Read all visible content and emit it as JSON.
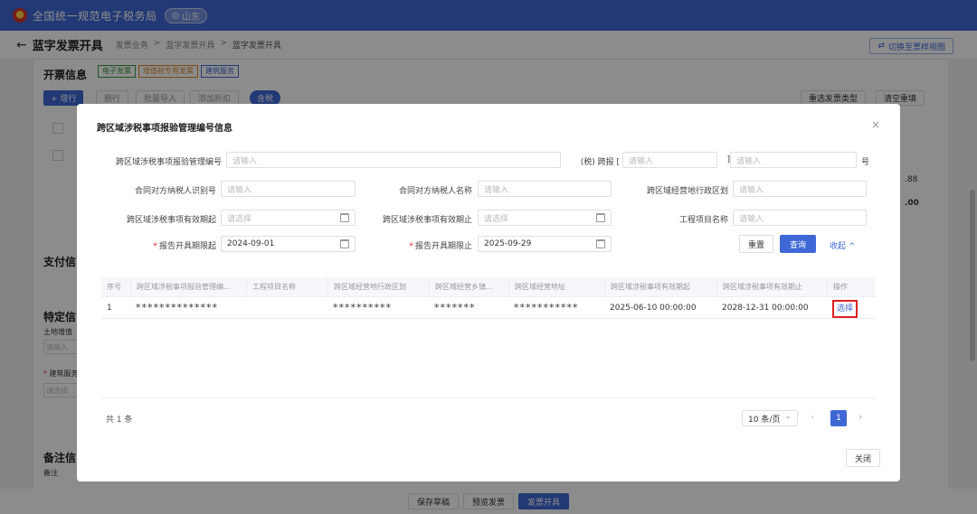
{
  "topbar": {
    "title": "全国统一规范电子税务局",
    "region": "山东"
  },
  "page": {
    "title": "蓝字发票开具",
    "breadcrumb": [
      "发票业务",
      "蓝字发票开具",
      "蓝字发票开具"
    ],
    "switch_label": "切换至票样视图"
  },
  "background": {
    "invoice_info_title": "开票信息",
    "tags": [
      "电子发票",
      "增值税专用发票",
      "建筑服务"
    ],
    "add_row": "+ 增行",
    "toolbar_extra": [
      "删行",
      "批量导入",
      "添加折扣",
      "含税"
    ],
    "select_type": "重选发票类型",
    "clear_fill": "清空重填",
    "payment_title": "支付信",
    "specific_title": "特定信",
    "land_label": "土地增值",
    "land_placeholder": "请输入",
    "construction_label": "建筑服务",
    "construction_placeholder": "请选择",
    "remark_title": "备注信",
    "remark_label": "备注",
    "right_values": [
      ".88",
      ".00"
    ]
  },
  "modal": {
    "title": "跨区域涉税事项报验管理编号信息",
    "form": {
      "mgmt_no_label": "跨区域涉税事项报验管理编号",
      "mgmt_no_placeholder": "请输入",
      "tax_prefix": "(税) 跨报 [",
      "tax_placeholder_1": "请输入",
      "bracket_close": "]",
      "tax_placeholder_2": "请输入",
      "suffix": "号",
      "counterpart_id_label": "合同对方纳税人识别号",
      "counterpart_id_placeholder": "请输入",
      "counterpart_name_label": "合同对方纳税人名称",
      "counterpart_name_placeholder": "请输入",
      "region_label": "跨区域经营地行政区划",
      "region_placeholder": "请输入",
      "valid_start_label": "跨区域涉税事项有效期起",
      "valid_start_placeholder": "请选择",
      "valid_end_label": "跨区域涉税事项有效期止",
      "valid_end_placeholder": "请选择",
      "project_label": "工程项目名称",
      "project_placeholder": "请输入",
      "report_start_label": "报告开具期限起",
      "report_start_value": "2024-09-01",
      "report_end_label": "报告开具期限止",
      "report_end_value": "2025-09-29",
      "reset": "重置",
      "query": "查询",
      "collapse": "收起 ^"
    },
    "table": {
      "headers": [
        "序号",
        "跨区域涉税事项报验管理编...",
        "工程项目名称",
        "跨区域经营地行政区划",
        "跨区域经营乡镇...",
        "跨区域经营地址",
        "跨区域涉税事项有效期起",
        "跨区域涉税事项有效期止",
        "操作"
      ],
      "rows": [
        [
          "1",
          "**************",
          "",
          "**********",
          "*******",
          "***********",
          "2025-06-10 00:00:00",
          "2028-12-31 00:00:00",
          "选择"
        ]
      ]
    },
    "total": "共 1 条",
    "page_size": "10 条/页",
    "current_page": "1",
    "close": "关闭"
  },
  "actionbar": {
    "save": "保存草稿",
    "preview": "预览发票",
    "issue": "发票开具"
  }
}
